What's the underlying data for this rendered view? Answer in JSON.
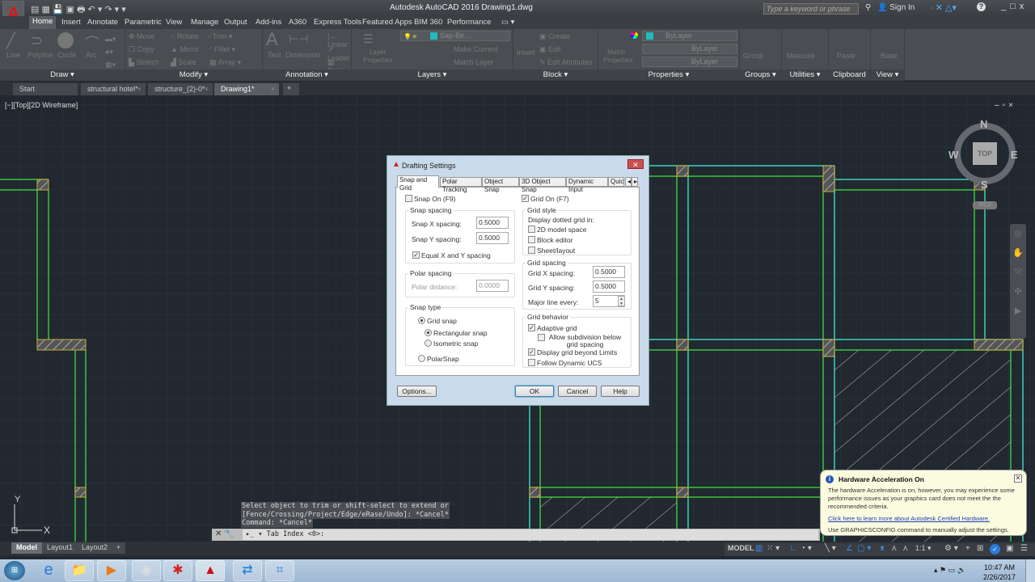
{
  "window": {
    "title": "Autodesk AutoCAD 2016    Drawing1.dwg",
    "search_placeholder": "Type a keyword or phrase",
    "sign_in": "Sign In",
    "help": "?"
  },
  "ribbon_tabs": [
    "Home",
    "Insert",
    "Annotate",
    "Parametric",
    "View",
    "Manage",
    "Output",
    "Add-ins",
    "A360",
    "Express Tools",
    "Featured Apps",
    "BIM 360",
    "Performance"
  ],
  "ribbon": {
    "draw": {
      "label": "Draw",
      "buttons": [
        "Line",
        "Polyline",
        "Circle",
        "Arc"
      ]
    },
    "modify": {
      "label": "Modify",
      "buttons": [
        "Move",
        "Rotate",
        "Trim",
        "Copy",
        "Mirror",
        "Fillet",
        "Stretch",
        "Scale",
        "Array"
      ]
    },
    "annotation": {
      "label": "Annotation",
      "buttons": [
        "Text",
        "Dimension",
        "Linear",
        "Leader",
        "Table"
      ]
    },
    "layers": {
      "label": "Layers",
      "buttons": [
        "Layer Properties",
        "Make Current",
        "Match Layer"
      ],
      "layer_value": "Sap-Be..."
    },
    "block": {
      "label": "Block",
      "buttons": [
        "Insert",
        "Create",
        "Edit",
        "Edit Attributes"
      ]
    },
    "properties": {
      "label": "Properties",
      "buttons": [
        "Match Properties"
      ],
      "color": "ByLayer",
      "linetype": "ByLayer",
      "lineweight": "ByLayer"
    },
    "groups": {
      "label": "Groups",
      "buttons": [
        "Group"
      ]
    },
    "utilities": {
      "label": "Utilities",
      "buttons": [
        "Measure"
      ]
    },
    "clipboard": {
      "label": "Clipboard",
      "buttons": [
        "Paste"
      ]
    },
    "view": {
      "label": "View",
      "buttons": [
        "Base"
      ]
    }
  },
  "doc_tabs": [
    {
      "label": "Start",
      "active": false
    },
    {
      "label": "structural hotel*",
      "active": false
    },
    {
      "label": "structure_(2)-0*",
      "active": false
    },
    {
      "label": "Drawing1*",
      "active": true
    }
  ],
  "viewport": {
    "label": "[−][Top][2D Wireframe]",
    "viewcube": {
      "face": "TOP",
      "n": "N",
      "s": "S",
      "e": "E",
      "w": "W",
      "ucs": "WCS"
    },
    "ucs_x": "X",
    "ucs_y": "Y"
  },
  "dialog": {
    "title": "Drafting Settings",
    "tabs": [
      "Snap and Grid",
      "Polar Tracking",
      "Object Snap",
      "3D Object Snap",
      "Dynamic Input",
      "Quic"
    ],
    "snap_on": {
      "label": "Snap On (F9)",
      "checked": false
    },
    "grid_on": {
      "label": "Grid On (F7)",
      "checked": true
    },
    "snap_spacing": {
      "title": "Snap spacing",
      "x_label": "Snap X spacing:",
      "x_value": "0.5000",
      "y_label": "Snap Y spacing:",
      "y_value": "0.5000",
      "equal_label": "Equal X and Y spacing",
      "equal_checked": true
    },
    "polar_spacing": {
      "title": "Polar spacing",
      "distance_label": "Polar distance:",
      "distance_value": "0.0000"
    },
    "snap_type": {
      "title": "Snap type",
      "grid_snap": "Grid snap",
      "rectangular": "Rectangular snap",
      "isometric": "Isometric snap",
      "polar": "PolarSnap"
    },
    "grid_style": {
      "title": "Grid style",
      "desc": "Display dotted grid in:",
      "model": "2D model space",
      "block": "Block editor",
      "sheet": "Sheet/layout"
    },
    "grid_spacing": {
      "title": "Grid spacing",
      "x_label": "Grid X spacing:",
      "x_value": "0.5000",
      "y_label": "Grid Y spacing:",
      "y_value": "0.5000",
      "major_label": "Major line every:",
      "major_value": "5"
    },
    "grid_behavior": {
      "title": "Grid behavior",
      "adaptive": "Adaptive grid",
      "subdivision": "Allow subdivision below grid spacing",
      "beyond": "Display grid beyond Limits",
      "dynamic_ucs": "Follow Dynamic UCS"
    },
    "buttons": {
      "options": "Options...",
      "ok": "OK",
      "cancel": "Cancel",
      "help": "Help"
    }
  },
  "command": {
    "history": [
      "Select object to trim or shift-select to extend or",
      "[Fence/Crossing/Project/Edge/eRase/Undo]: *Cancel*",
      "Command: *Cancel*"
    ],
    "prompt": "Tab Index <0>:"
  },
  "layout_tabs": [
    "Model",
    "Layout1",
    "Layout2"
  ],
  "status": {
    "model": "MODEL",
    "scale": "1:1"
  },
  "balloon": {
    "title": "Hardware Acceleration On",
    "body": "The hardware Acceleration is on, however, you may experience some performance issues as your graphics card does not meet the the recommended criteria.",
    "link": "Click here to learn more about  Autodesk Certified Hardware.",
    "footer": "Use GRAPHICSCONFIG command to manually adjust the settings."
  },
  "taskbar": {
    "time": "10:47 AM",
    "date": "2/26/2017"
  },
  "colors": {
    "cyan": "#3fd0c0",
    "green": "#3cc43c",
    "hatch_col": "#c8b040",
    "bg": "#212830"
  }
}
